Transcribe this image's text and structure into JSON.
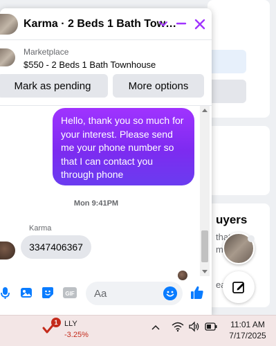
{
  "chat": {
    "title": "Karma · 2 Beds 1 Bath Tow…",
    "marketplace_label": "Marketplace",
    "listing": "$550 - 2 Beds 1 Bath Townhouse",
    "buttons": {
      "mark_pending": "Mark as pending",
      "more_options": "More options"
    },
    "messages": {
      "outgoing": "Hello, thank you so much for your interest. Please send me your phone number so that I can contact you through phone",
      "timestamp": "Mon 9:41PM",
      "sender_name": "Karma",
      "incoming": "3347406367"
    },
    "composer": {
      "placeholder": "Aa",
      "gif_label": "GIF"
    },
    "accent_color": "#7d2bf0",
    "icons": [
      "chevron-down-icon",
      "minimize-icon",
      "close-icon",
      "microphone-icon",
      "photo-icon",
      "sticker-icon",
      "gif-icon",
      "emoji-icon",
      "thumbs-up-icon"
    ]
  },
  "background": {
    "section_heading": "uyers",
    "section_text_1": "that",
    "section_text_2": "mo",
    "section_text_3": "ear"
  },
  "floating": {
    "icons": [
      "contact-avatar",
      "new-message-icon"
    ]
  },
  "taskbar": {
    "stock_symbol": "LLY",
    "stock_change": "-3.25%",
    "badge_count": "1",
    "time": "11:01 AM",
    "date": "7/17/2025",
    "icons": [
      "chevron-up-icon",
      "wifi-icon",
      "volume-icon",
      "battery-icon"
    ]
  }
}
